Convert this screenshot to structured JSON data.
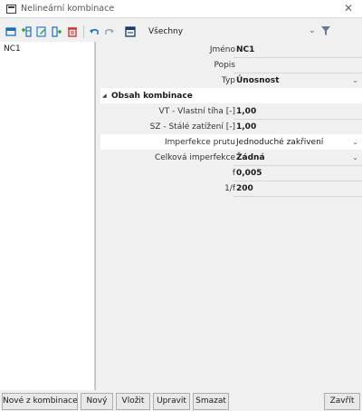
{
  "window": {
    "title": "Nelineární kombinace"
  },
  "toolbar": {
    "filter_value": "Všechny",
    "icons": [
      "new-icon",
      "insert-icon",
      "edit-icon",
      "copy-icon",
      "delete-icon",
      "undo-icon",
      "redo-icon",
      "table-icon"
    ]
  },
  "list": {
    "items": [
      {
        "label": "NC1"
      }
    ]
  },
  "properties": {
    "name": {
      "label": "Jméno",
      "value": "NC1"
    },
    "description": {
      "label": "Popis",
      "value": ""
    },
    "type": {
      "label": "Typ",
      "value": "Únosnost"
    },
    "section_title": "Obsah kombinace",
    "vt": {
      "label": "VT - Vlastní tíha [-]",
      "value": "1,00"
    },
    "sz": {
      "label": "SZ - Stálé zatížení [-]",
      "value": "1,00"
    },
    "member_imperfection": {
      "label": "Imperfekce prutu",
      "value": "Jednoduché zakřivení"
    },
    "global_imperfection": {
      "label": "Celková imperfekce",
      "value": "Žádná"
    },
    "f": {
      "label": "f",
      "value": "0,005"
    },
    "inv_f": {
      "label": "1/f",
      "value": "200"
    }
  },
  "buttons": {
    "new_from_combination": "Nové z kombinace",
    "new": "Nový",
    "insert": "Vložit",
    "edit": "Upravit",
    "delete": "Smazat",
    "close": "Zavřít"
  },
  "colors": {
    "accent_blue": "#1a6fb3",
    "delete_red": "#d62828",
    "insert_green": "#2e9e3a",
    "edit_blue": "#2a7fd4"
  }
}
